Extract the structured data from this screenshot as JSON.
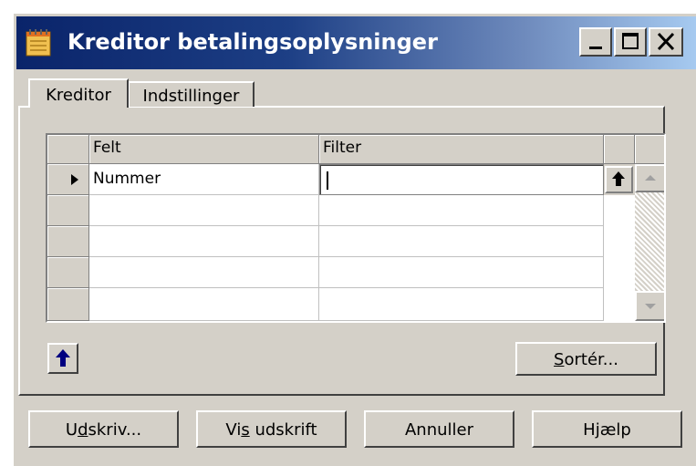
{
  "window": {
    "title": "Kreditor betalingsoplysninger"
  },
  "title_buttons": {
    "minimize": "_",
    "maximize": "□",
    "close": "X"
  },
  "tabs": [
    {
      "label": "Kreditor",
      "active": true
    },
    {
      "label": "Indstillinger",
      "active": false
    }
  ],
  "grid": {
    "columns": [
      "Felt",
      "Filter"
    ],
    "rows": [
      {
        "felt": "Nummer",
        "filter": "",
        "current": true
      },
      {
        "felt": "",
        "filter": ""
      },
      {
        "felt": "",
        "filter": ""
      },
      {
        "felt": "",
        "filter": ""
      },
      {
        "felt": "",
        "filter": ""
      }
    ]
  },
  "buttons": {
    "sort": {
      "label": "Sortér...",
      "mnemonic_index": 0
    },
    "print": {
      "label": "Udskriv...",
      "mnemonic_index": 1
    },
    "preview": {
      "label": "Vis udskrift",
      "mnemonic_index": 2
    },
    "cancel": {
      "label": "Annuller"
    },
    "help": {
      "label": "Hjælp"
    }
  },
  "colors": {
    "titlebar_start": "#0a246a",
    "titlebar_end": "#a6caf0",
    "face": "#d4d0c8",
    "arrow_blue": "#000080"
  }
}
